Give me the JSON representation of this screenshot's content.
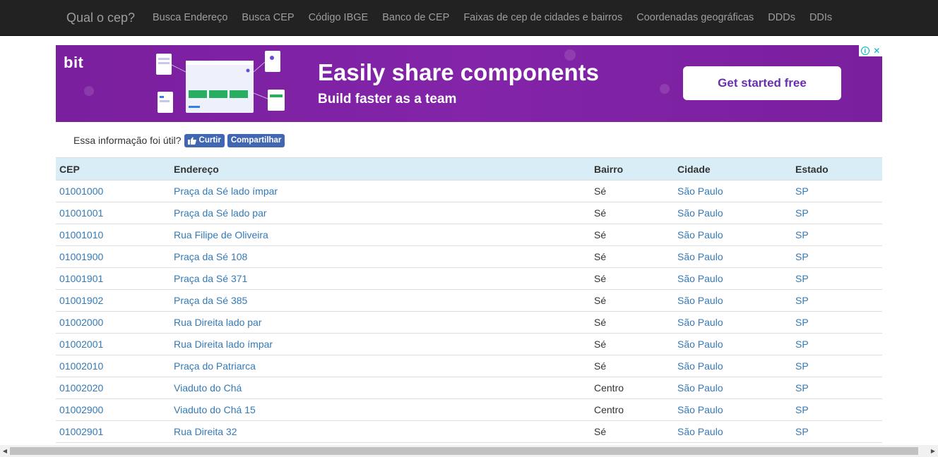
{
  "navbar": {
    "brand": "Qual o cep?",
    "links": [
      "Busca Endereço",
      "Busca CEP",
      "Código IBGE",
      "Banco de CEP",
      "Faixas de cep de cidades e bairros",
      "Coordenadas geográficas",
      "DDDs",
      "DDIs"
    ]
  },
  "ad": {
    "logo": "bit",
    "headline": "Easily share components",
    "subheadline": "Build faster as a team",
    "cta": "Get started free",
    "info_icon": "i",
    "close_icon": "✕",
    "background_color": "#7b1fa2"
  },
  "social": {
    "prompt": "Essa informação foi útil?",
    "like_label": "Curtir",
    "share_label": "Compartilhar",
    "button_color": "#4267b2"
  },
  "table": {
    "headers": [
      "CEP",
      "Endereço",
      "Bairro",
      "Cidade",
      "Estado"
    ],
    "header_bg": "#d9edf7",
    "link_color": "#337ab7",
    "rows": [
      [
        "01001000",
        "Praça da Sé lado ímpar",
        "Sé",
        "São Paulo",
        "SP"
      ],
      [
        "01001001",
        "Praça da Sé lado par",
        "Sé",
        "São Paulo",
        "SP"
      ],
      [
        "01001010",
        "Rua Filipe de Oliveira",
        "Sé",
        "São Paulo",
        "SP"
      ],
      [
        "01001900",
        "Praça da Sé 108",
        "Sé",
        "São Paulo",
        "SP"
      ],
      [
        "01001901",
        "Praça da Sé 371",
        "Sé",
        "São Paulo",
        "SP"
      ],
      [
        "01001902",
        "Praça da Sé 385",
        "Sé",
        "São Paulo",
        "SP"
      ],
      [
        "01002000",
        "Rua Direita lado par",
        "Sé",
        "São Paulo",
        "SP"
      ],
      [
        "01002001",
        "Rua Direita lado ímpar",
        "Sé",
        "São Paulo",
        "SP"
      ],
      [
        "01002010",
        "Praça do Patriarca",
        "Sé",
        "São Paulo",
        "SP"
      ],
      [
        "01002020",
        "Viaduto do Chá",
        "Centro",
        "São Paulo",
        "SP"
      ],
      [
        "01002900",
        "Viaduto do Chá 15",
        "Centro",
        "São Paulo",
        "SP"
      ],
      [
        "01002901",
        "Rua Direita 32",
        "Sé",
        "São Paulo",
        "SP"
      ]
    ]
  },
  "scrollbar": {
    "left_arrow_icon": "◀",
    "right_arrow_icon": "▶"
  }
}
